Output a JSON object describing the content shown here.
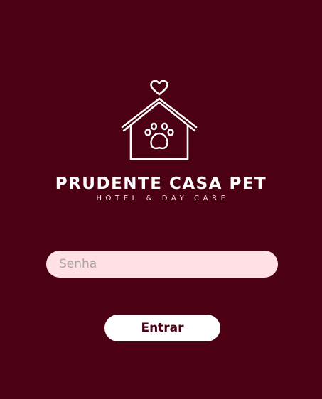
{
  "brand": {
    "name": "PRUDENTE CASA PET",
    "tagline": "HOTEL & DAY CARE"
  },
  "login": {
    "password_placeholder": "Senha",
    "password_value": "",
    "submit_label": "Entrar"
  },
  "colors": {
    "background": "#4b0014",
    "input_background": "#ffe0e5",
    "button_background": "#ffffff",
    "button_text": "#4b0014"
  },
  "icons": [
    "heart-icon",
    "house-icon",
    "paw-icon"
  ]
}
